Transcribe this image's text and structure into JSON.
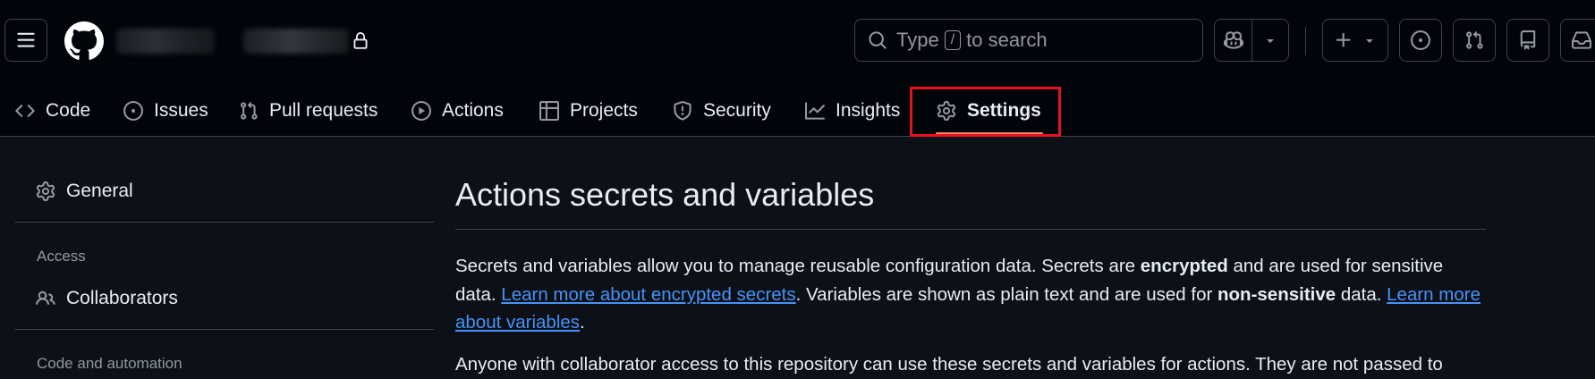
{
  "header": {
    "search_prefix": "Type",
    "search_key": "/",
    "search_suffix": "to search"
  },
  "tabs": [
    {
      "label": "Code",
      "icon": "code-icon"
    },
    {
      "label": "Issues",
      "icon": "issue-opened-icon"
    },
    {
      "label": "Pull requests",
      "icon": "git-pull-request-icon"
    },
    {
      "label": "Actions",
      "icon": "play-icon"
    },
    {
      "label": "Projects",
      "icon": "table-icon"
    },
    {
      "label": "Security",
      "icon": "shield-icon"
    },
    {
      "label": "Insights",
      "icon": "graph-icon"
    },
    {
      "label": "Settings",
      "icon": "gear-icon",
      "selected": true
    }
  ],
  "sidebar": {
    "general_label": "General",
    "access_heading": "Access",
    "collaborators_label": "Collaborators",
    "code_automation_heading": "Code and automation"
  },
  "main": {
    "title": "Actions secrets and variables",
    "p1": {
      "t1": "Secrets and variables allow you to manage reusable configuration data. Secrets are ",
      "b1": "encrypted",
      "t2": " and are used for sensitive data. ",
      "link1": "Learn more about encrypted secrets",
      "t3": ". Variables are shown as plain text and are used for ",
      "b2": "non-sensitive",
      "t4": " data. ",
      "link2": "Learn more about variables",
      "t5": "."
    },
    "p2": "Anyone with collaborator access to this repository can use these secrets and variables for actions. They are not passed to"
  },
  "colors": {
    "background": "#0d1117",
    "header_bg": "#010409",
    "link": "#4493f8",
    "highlight": "#e5121f",
    "tab_underline": "#f78166"
  }
}
